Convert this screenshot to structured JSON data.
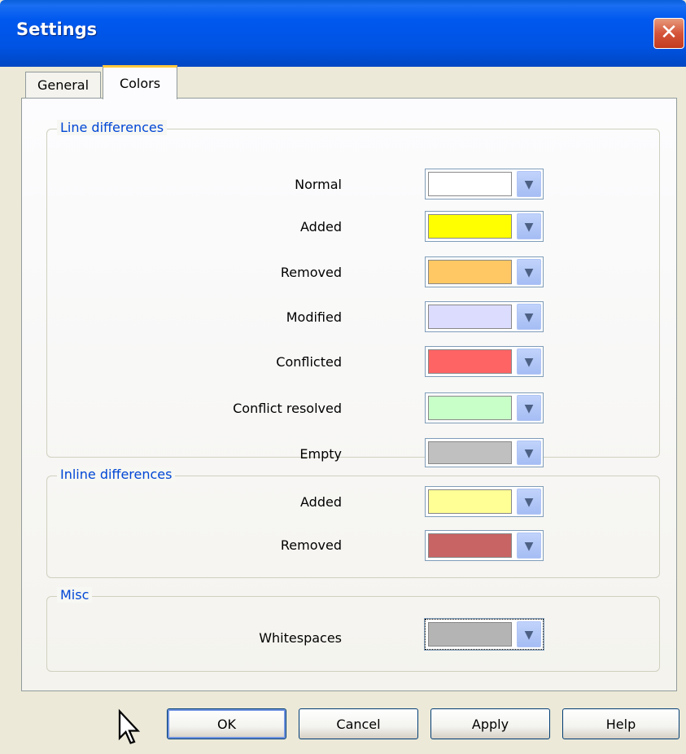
{
  "window": {
    "title": "Settings",
    "close_symbol": "✕"
  },
  "tabs": [
    {
      "label": "General",
      "active": false
    },
    {
      "label": "Colors",
      "active": true
    }
  ],
  "groups": {
    "line_differences": {
      "label": "Line differences",
      "rows": [
        {
          "label": "Normal",
          "color": "#ffffff"
        },
        {
          "label": "Added",
          "color": "#ffff00"
        },
        {
          "label": "Removed",
          "color": "#ffc864"
        },
        {
          "label": "Modified",
          "color": "#dcdcff"
        },
        {
          "label": "Conflicted",
          "color": "#ff6464"
        },
        {
          "label": "Conflict resolved",
          "color": "#c8ffc8"
        },
        {
          "label": "Empty",
          "color": "#c0c0c0"
        }
      ]
    },
    "inline_differences": {
      "label": "Inline differences",
      "rows": [
        {
          "label": "Added",
          "color": "#ffff96"
        },
        {
          "label": "Removed",
          "color": "#c86464"
        }
      ]
    },
    "misc": {
      "label": "Misc",
      "rows": [
        {
          "label": "Whitespaces",
          "color": "#b4b4b4"
        }
      ]
    }
  },
  "buttons": {
    "ok": "OK",
    "cancel": "Cancel",
    "apply": "Apply",
    "help": "Help"
  },
  "icons": {
    "dropdown": "chevron-down-icon",
    "close": "close-icon",
    "cursor": "mouse-pointer-icon"
  }
}
